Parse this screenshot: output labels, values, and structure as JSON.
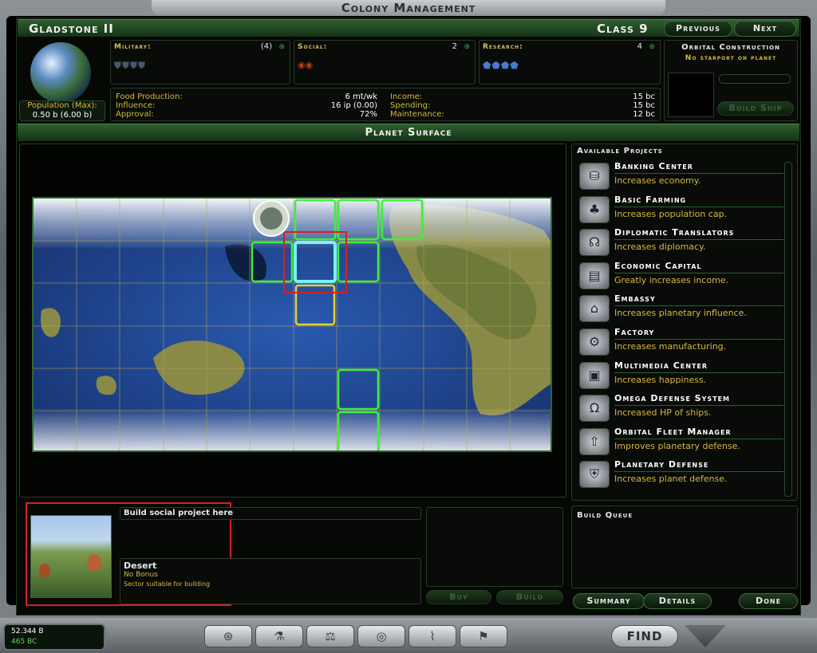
{
  "title": "Colony Management",
  "planet": {
    "name": "Gladstone II",
    "class": "Class 9",
    "pop_label": "Population (Max):",
    "pop_value": "0.50 b (6.00 b)"
  },
  "nav": {
    "previous": "Previous",
    "next": "Next"
  },
  "military": {
    "label": "Military:",
    "value": "(4)"
  },
  "social": {
    "label": "Social:",
    "value": "2"
  },
  "research": {
    "label": "Research:",
    "value": "4"
  },
  "stats": {
    "food_label": "Food Production:",
    "food_value": "6 mt/wk",
    "influence_label": "Influence:",
    "influence_value": "16 ip (0.00)",
    "approval_label": "Approval:",
    "approval_value": "72%",
    "income_label": "Income:",
    "income_value": "15 bc",
    "spending_label": "Spending:",
    "spending_value": "15 bc",
    "maintenance_label": "Maintenance:",
    "maintenance_value": "12 bc"
  },
  "orbital": {
    "title": "Orbital Construction",
    "msg": "No starport on planet",
    "build_ship": "Build Ship"
  },
  "surface_title": "Planet Surface",
  "projects": {
    "title": "Available Projects",
    "items": [
      {
        "name": "Banking Center",
        "desc": "Increases economy.",
        "icon": "bank-icon"
      },
      {
        "name": "Basic Farming",
        "desc": "Increases population cap.",
        "icon": "farm-icon"
      },
      {
        "name": "Diplomatic Translators",
        "desc": "Increases diplomacy.",
        "icon": "translator-icon"
      },
      {
        "name": "Economic Capital",
        "desc": "Greatly increases income.",
        "icon": "capital-icon"
      },
      {
        "name": "Embassy",
        "desc": "Increases planetary influence.",
        "icon": "embassy-icon"
      },
      {
        "name": "Factory",
        "desc": "Increases manufacturing.",
        "icon": "factory-icon"
      },
      {
        "name": "Multimedia Center",
        "desc": "Increases happiness.",
        "icon": "media-icon"
      },
      {
        "name": "Omega Defense System",
        "desc": "Increased HP of ships.",
        "icon": "omega-icon"
      },
      {
        "name": "Orbital Fleet Manager",
        "desc": "Improves planetary defense.",
        "icon": "fleet-icon"
      },
      {
        "name": "Planetary Defense",
        "desc": "Increases planet defense.",
        "icon": "defense-icon"
      }
    ]
  },
  "build_queue": "Build Queue",
  "tile": {
    "heading": "Build social project here",
    "terrain": "Desert",
    "bonus": "No Bonus",
    "note": "Sector suitable for building"
  },
  "actions": {
    "buy": "Buy",
    "build": "Build",
    "summary": "Summary",
    "details": "Details",
    "done": "Done"
  },
  "empire": {
    "population": "52.344 B",
    "credits": "465 BC"
  },
  "find": "FIND"
}
